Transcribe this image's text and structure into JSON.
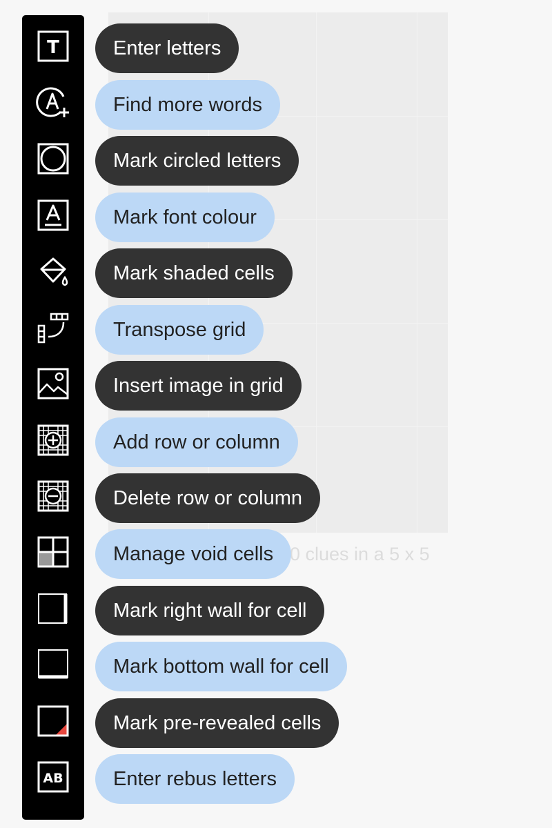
{
  "status": {
    "text": "0 clues in a 5 x 5"
  },
  "tools": [
    {
      "label": "Enter letters",
      "icon": "text-tool-icon",
      "style": "dark"
    },
    {
      "label": "Find more words",
      "icon": "find-words-icon",
      "style": "light"
    },
    {
      "label": "Mark circled letters",
      "icon": "circled-letters-icon",
      "style": "dark"
    },
    {
      "label": "Mark font colour",
      "icon": "font-colour-icon",
      "style": "light"
    },
    {
      "label": "Mark shaded cells",
      "icon": "paint-bucket-icon",
      "style": "dark"
    },
    {
      "label": "Transpose grid",
      "icon": "transpose-grid-icon",
      "style": "light"
    },
    {
      "label": "Insert image in grid",
      "icon": "image-icon",
      "style": "dark"
    },
    {
      "label": "Add row or column",
      "icon": "add-row-column-icon",
      "style": "light"
    },
    {
      "label": "Delete row or column",
      "icon": "delete-row-column-icon",
      "style": "dark"
    },
    {
      "label": "Manage void cells",
      "icon": "void-cells-icon",
      "style": "light"
    },
    {
      "label": "Mark right wall for cell",
      "icon": "right-wall-icon",
      "style": "dark"
    },
    {
      "label": "Mark bottom wall for cell",
      "icon": "bottom-wall-icon",
      "style": "light"
    },
    {
      "label": "Mark pre-revealed cells",
      "icon": "pre-revealed-icon",
      "style": "dark"
    },
    {
      "label": "Enter rebus letters",
      "icon": "rebus-icon",
      "style": "light"
    }
  ],
  "icon_text": {
    "text_tool": "T",
    "rebus": "AB"
  },
  "colors": {
    "pill_dark": "#333333",
    "pill_light": "#bcd8f6",
    "toolbar": "#000000",
    "pre_revealed_corner": "#e8483f"
  }
}
